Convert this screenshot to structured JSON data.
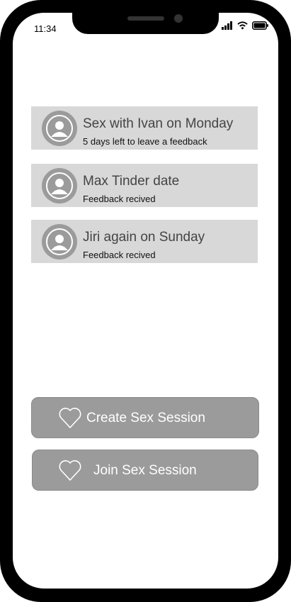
{
  "status_bar": {
    "time": "11:34"
  },
  "sessions": [
    {
      "title": "Sex with Ivan on Monday",
      "subtitle": "5 days left to leave a feedback"
    },
    {
      "title": "Max Tinder date",
      "subtitle": "Feedback recived"
    },
    {
      "title": "Jiri again on Sunday",
      "subtitle": "Feedback recived"
    }
  ],
  "actions": {
    "create_label": "Create Sex Session",
    "join_label": "Join Sex Session"
  }
}
